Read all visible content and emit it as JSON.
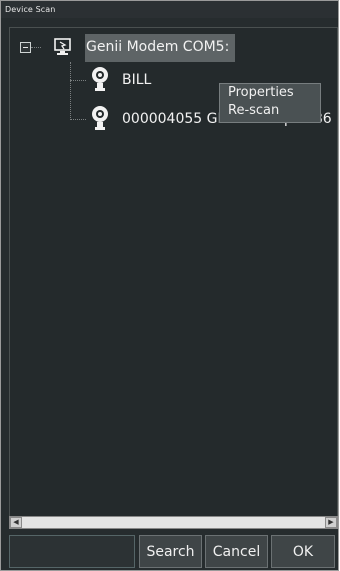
{
  "window": {
    "title": "Device Scan"
  },
  "tree": {
    "root": {
      "label": "Genii Modem COM5:",
      "icon": "computer-port-icon",
      "expander": "minus-icon"
    },
    "children": [
      {
        "label": "BILL",
        "icon": "transmitter-device-icon"
      },
      {
        "label": "000004055 GE Flow Liquid 86",
        "icon": "transmitter-device-icon"
      }
    ]
  },
  "context_menu": {
    "items": [
      {
        "label": "Properties"
      },
      {
        "label": "Re-scan"
      }
    ]
  },
  "scrollbar": {
    "left_icon": "arrow-left-icon",
    "right_icon": "arrow-right-icon"
  },
  "footer": {
    "search_value": "",
    "search_label": "Search",
    "cancel_label": "Cancel",
    "ok_label": "OK"
  }
}
